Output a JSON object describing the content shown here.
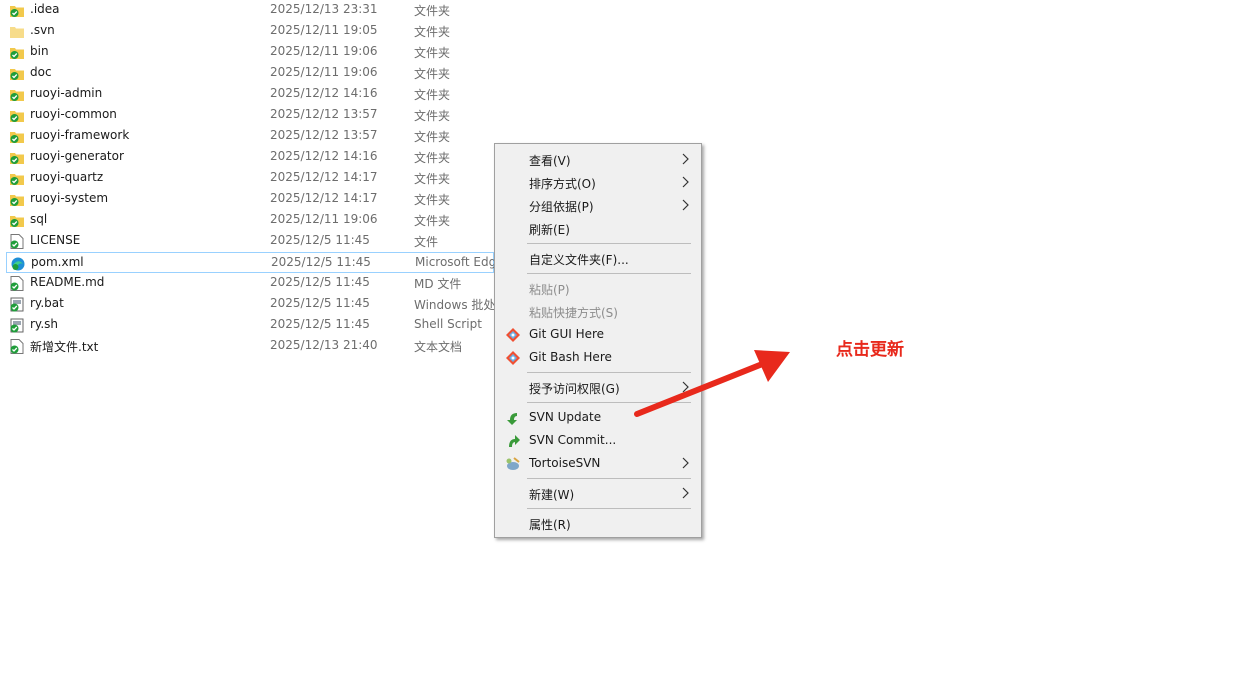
{
  "files": [
    {
      "name": ".idea",
      "date": "2025/12/13 23:31",
      "type": "文件夹",
      "icon": "folder-svn-ok-icon"
    },
    {
      "name": ".svn",
      "date": "2025/12/11 19:05",
      "type": "文件夹",
      "icon": "folder-icon"
    },
    {
      "name": "bin",
      "date": "2025/12/11 19:06",
      "type": "文件夹",
      "icon": "folder-svn-ok-icon"
    },
    {
      "name": "doc",
      "date": "2025/12/11 19:06",
      "type": "文件夹",
      "icon": "folder-svn-ok-icon"
    },
    {
      "name": "ruoyi-admin",
      "date": "2025/12/12 14:16",
      "type": "文件夹",
      "icon": "folder-svn-ok-icon"
    },
    {
      "name": "ruoyi-common",
      "date": "2025/12/12 13:57",
      "type": "文件夹",
      "icon": "folder-svn-ok-icon"
    },
    {
      "name": "ruoyi-framework",
      "date": "2025/12/12 13:57",
      "type": "文件夹",
      "icon": "folder-svn-ok-icon"
    },
    {
      "name": "ruoyi-generator",
      "date": "2025/12/12 14:16",
      "type": "文件夹",
      "icon": "folder-svn-ok-icon"
    },
    {
      "name": "ruoyi-quartz",
      "date": "2025/12/12 14:17",
      "type": "文件夹",
      "icon": "folder-svn-ok-icon"
    },
    {
      "name": "ruoyi-system",
      "date": "2025/12/12 14:17",
      "type": "文件夹",
      "icon": "folder-svn-ok-icon"
    },
    {
      "name": "sql",
      "date": "2025/12/11 19:06",
      "type": "文件夹",
      "icon": "folder-svn-ok-icon"
    },
    {
      "name": "LICENSE",
      "date": "2025/12/5 11:45",
      "type": "文件",
      "icon": "file-svn-ok-icon"
    },
    {
      "name": "pom.xml",
      "date": "2025/12/5 11:45",
      "type": "Microsoft Edge",
      "icon": "edge-file-icon",
      "selected": true
    },
    {
      "name": "README.md",
      "date": "2025/12/5 11:45",
      "type": "MD 文件",
      "icon": "file-svn-ok-icon"
    },
    {
      "name": "ry.bat",
      "date": "2025/12/5 11:45",
      "type": "Windows 批处理",
      "icon": "script-svn-ok-icon"
    },
    {
      "name": "ry.sh",
      "date": "2025/12/5 11:45",
      "type": "Shell Script",
      "icon": "script-svn-ok-icon"
    },
    {
      "name": "新增文件.txt",
      "date": "2025/12/13 21:40",
      "type": "文本文档",
      "icon": "file-svn-ok-icon"
    }
  ],
  "menu": {
    "view": "查看(V)",
    "sort": "排序方式(O)",
    "group": "分组依据(P)",
    "refresh": "刷新(E)",
    "customize": "自定义文件夹(F)...",
    "paste": "粘贴(P)",
    "paste_shortcut": "粘贴快捷方式(S)",
    "git_gui": "Git GUI Here",
    "git_bash": "Git Bash Here",
    "grant_access": "授予访问权限(G)",
    "svn_update": "SVN Update",
    "svn_commit": "SVN Commit...",
    "tortoise": "TortoiseSVN",
    "new": "新建(W)",
    "properties": "属性(R)"
  },
  "annotation": {
    "text": "点击更新",
    "color": "#e8291c"
  },
  "colors": {
    "selection_border": "#99d1ff",
    "svn_ok_green": "#1f9d3a",
    "folder_yellow": "#f2c94c"
  }
}
